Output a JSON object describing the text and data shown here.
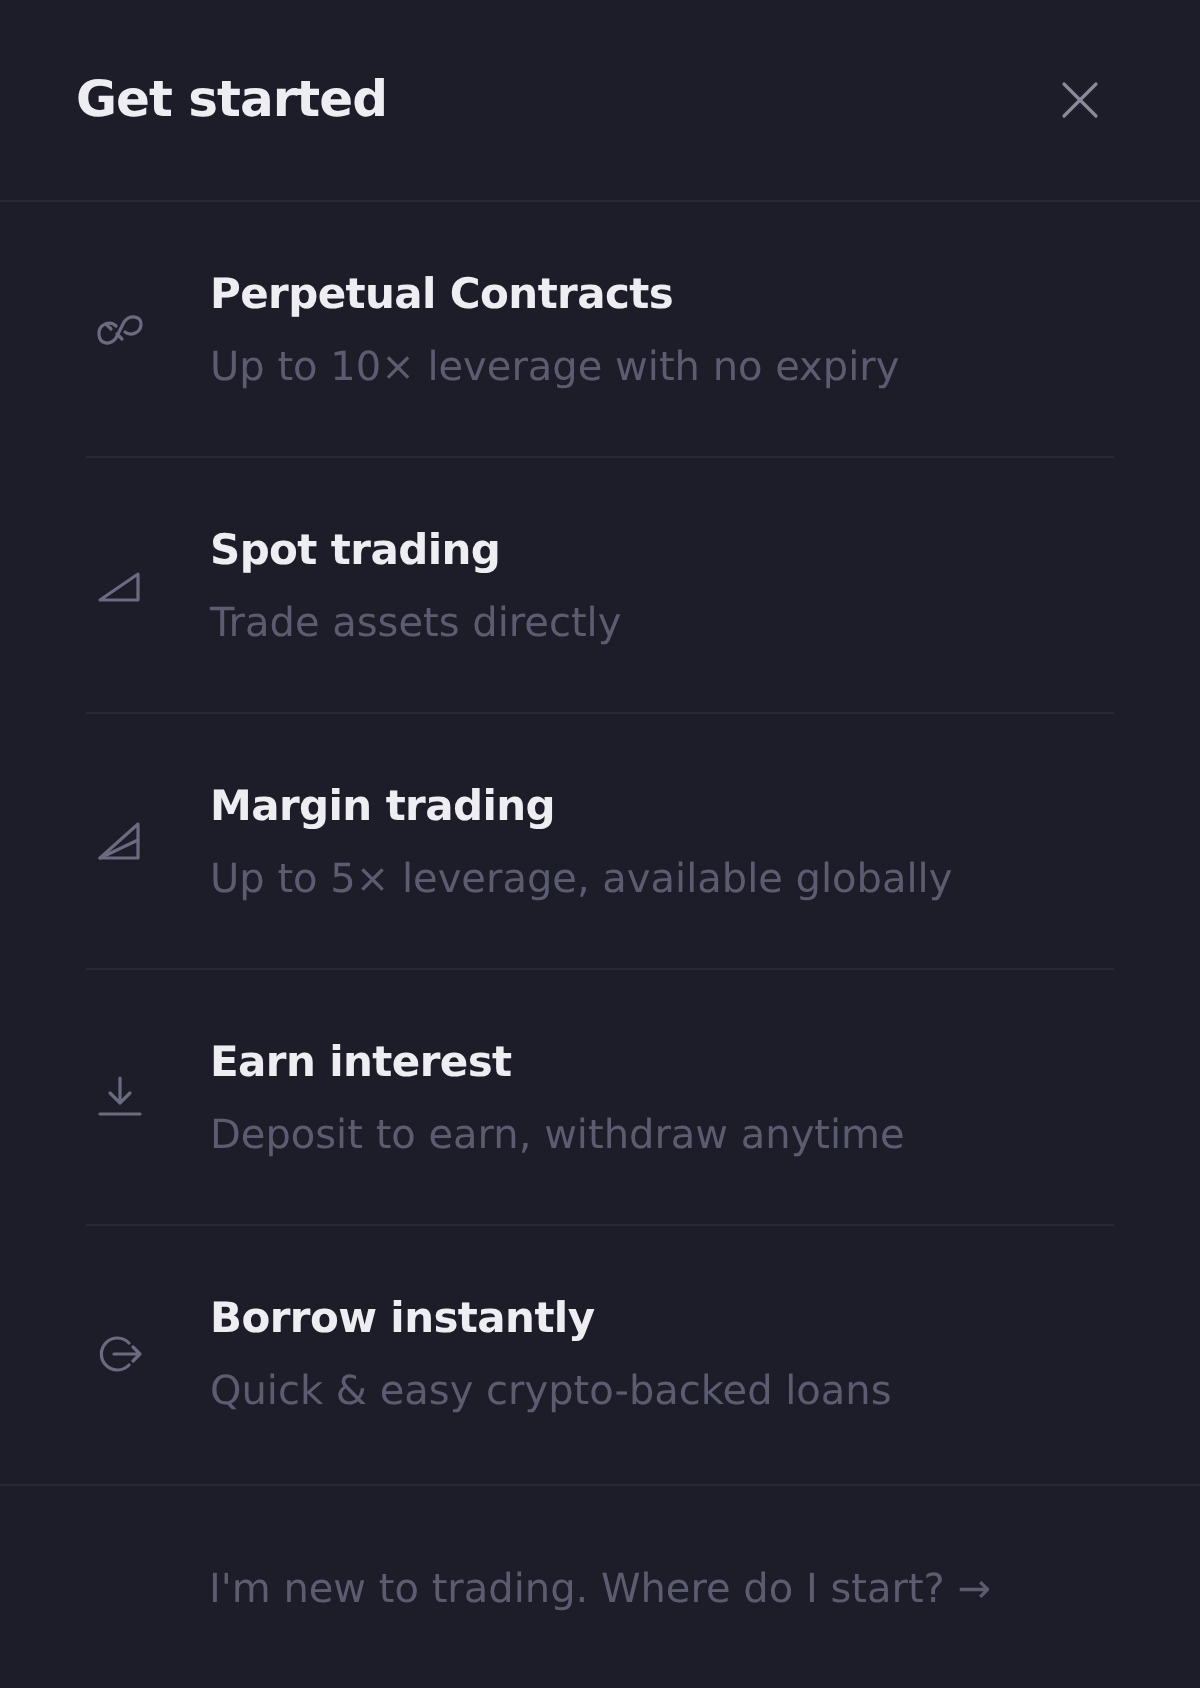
{
  "header": {
    "title": "Get started"
  },
  "options": [
    {
      "kind": "perpetual",
      "title": "Perpetual Contracts",
      "subtitle": "Up to 10× leverage with no expiry"
    },
    {
      "kind": "spot",
      "title": "Spot trading",
      "subtitle": "Trade assets directly"
    },
    {
      "kind": "margin",
      "title": "Margin trading",
      "subtitle": "Up to 5× leverage, available globally"
    },
    {
      "kind": "earn",
      "title": "Earn interest",
      "subtitle": "Deposit to earn, withdraw anytime"
    },
    {
      "kind": "borrow",
      "title": "Borrow instantly",
      "subtitle": "Quick & easy crypto-backed loans"
    }
  ],
  "footer_link": {
    "text": "I'm new to trading. Where do I start? →"
  }
}
